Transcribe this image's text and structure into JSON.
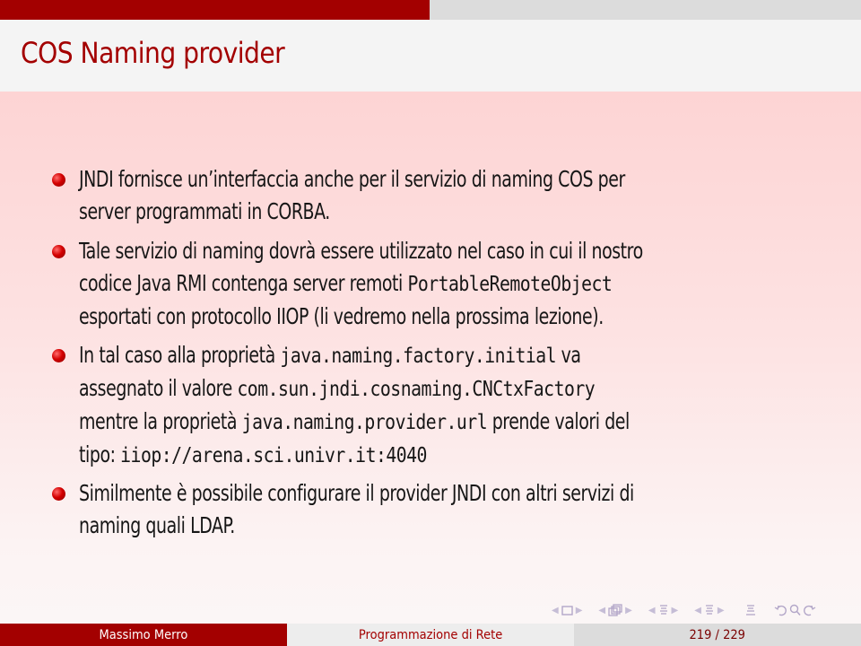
{
  "slide": {
    "title": "COS Naming provider",
    "items": [
      {
        "lines": [
          [
            {
              "t": "JNDI fornisce un’interfaccia anche per il servizio di naming COS per"
            }
          ],
          [
            {
              "t": "server programmati in CORBA."
            }
          ]
        ]
      },
      {
        "lines": [
          [
            {
              "t": "Tale servizio di naming dovrà essere utilizzato nel caso in cui il nostro"
            }
          ],
          [
            {
              "t": "codice Java RMI contenga server remoti "
            },
            {
              "t": "PortableRemoteObject",
              "code": true
            }
          ],
          [
            {
              "t": "esportati con protocollo IIOP (li vedremo nella prossima lezione)."
            }
          ]
        ]
      },
      {
        "lines": [
          [
            {
              "t": "In tal caso alla proprietà "
            },
            {
              "t": "java.naming.factory.initial",
              "code": true
            },
            {
              "t": " va"
            }
          ],
          [
            {
              "t": "assegnato il valore "
            },
            {
              "t": "com.sun.jndi.cosnaming.CNCtxFactory",
              "code": true
            }
          ],
          [
            {
              "t": "mentre la proprietà "
            },
            {
              "t": "java.naming.provider.url",
              "code": true
            },
            {
              "t": " prende valori del"
            }
          ],
          [
            {
              "t": "tipo: "
            },
            {
              "t": "iiop://arena.sci.univr.it:4040",
              "code": true
            }
          ]
        ]
      },
      {
        "lines": [
          [
            {
              "t": "Similmente è possibile configurare il provider JNDI con altri servizi di"
            }
          ],
          [
            {
              "t": "naming quali LDAP."
            }
          ]
        ]
      }
    ]
  },
  "navigation": {
    "icons": [
      "prev-slide",
      "frame-icon",
      "next-slide",
      "prev-subsection",
      "subsection-icon",
      "next-subsection",
      "prev-section",
      "section-icon",
      "next-section",
      "prev-section-2",
      "section-icon-2",
      "next-section-2",
      "document-icon",
      "back-icon",
      "search-icon",
      "forward-icon"
    ]
  },
  "footer": {
    "author": "Massimo Merro",
    "course": "Programmazione di Rete",
    "page_current": "219",
    "page_total": "229",
    "page_label": "219 / 229"
  },
  "colors": {
    "accent": "#a30000",
    "body_bg_top": "#fdd4d4",
    "title_bg": "#f4f4f4"
  }
}
